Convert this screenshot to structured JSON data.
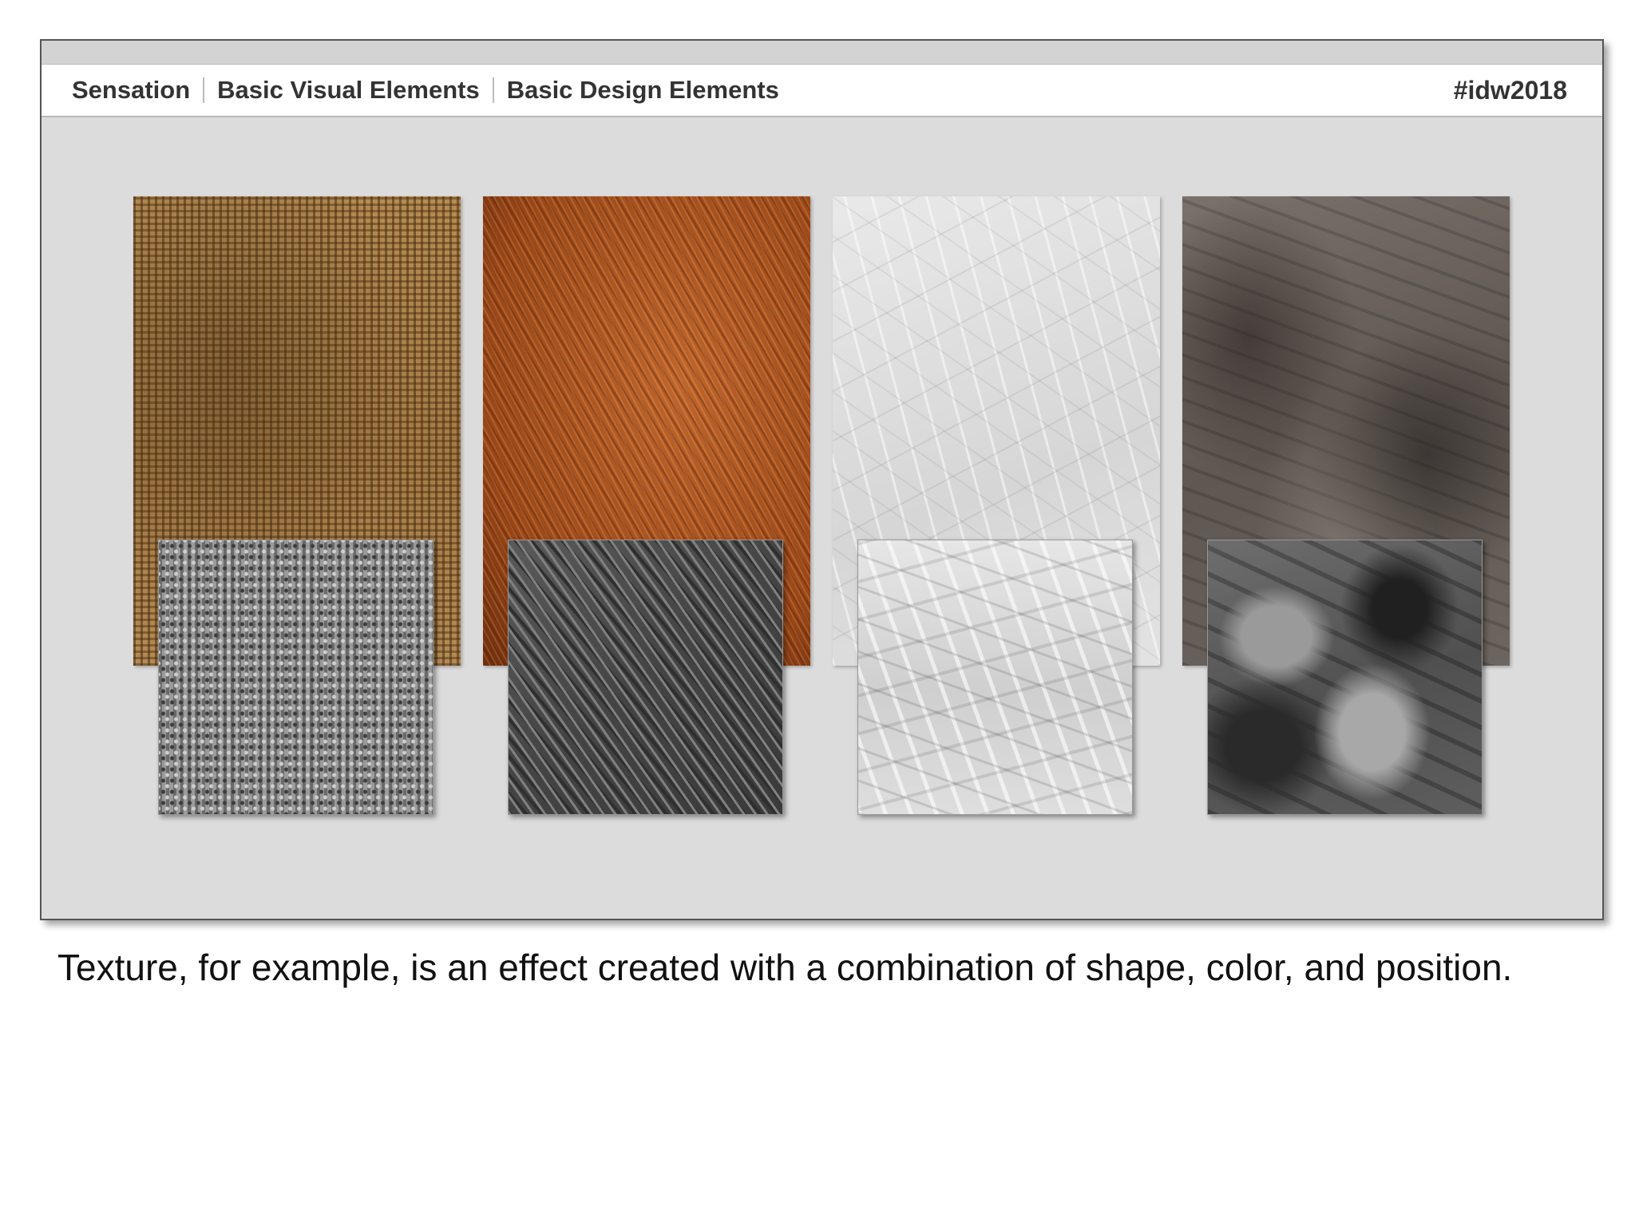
{
  "header": {
    "breadcrumbs": [
      "Sensation",
      "Basic Visual Elements",
      "Basic Design Elements"
    ],
    "hashtag": "#idw2018"
  },
  "textures": [
    {
      "name": "burlap",
      "photo_icon": "burlap-texture-image",
      "vector_icon": "burlap-vector-texture-image"
    },
    {
      "name": "fur",
      "photo_icon": "fur-texture-image",
      "vector_icon": "fur-vector-texture-image"
    },
    {
      "name": "paper",
      "photo_icon": "crumpled-paper-texture-image",
      "vector_icon": "crumpled-paper-vector-texture-image"
    },
    {
      "name": "rock",
      "photo_icon": "rock-texture-image",
      "vector_icon": "rock-vector-texture-image"
    }
  ],
  "caption": "Texture, for example, is an effect created with a combination of shape, color, and position."
}
